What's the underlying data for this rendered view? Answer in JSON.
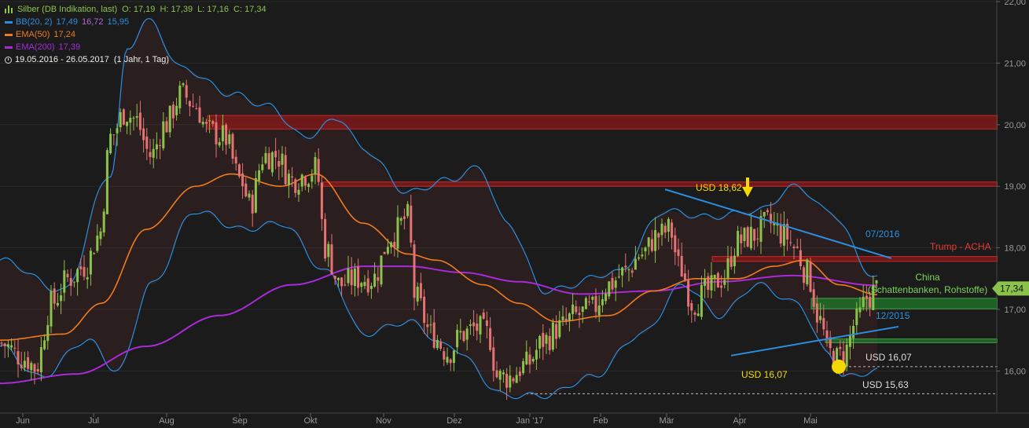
{
  "legend": {
    "main": {
      "name": "Silber (DB Indikation, last)",
      "ohlc": "O: 17,19  H: 17,39  L: 17,16  C: 17,34",
      "color": "#8bc34a"
    },
    "bb": {
      "name": "BB(20, 2)",
      "upper": "17,49",
      "mid": "16,72",
      "lower": "15,95",
      "color": "#2a8fe0"
    },
    "ema50": {
      "name": "EMA(50)",
      "value": "17,24",
      "color": "#f07b1d"
    },
    "ema200": {
      "name": "EMA(200)",
      "value": "17,39",
      "color": "#a82ad8"
    },
    "range": {
      "dates": "19.05.2016 - 26.05.2017",
      "period": "(1 Jahr, 1 Tag)"
    }
  },
  "chart_data": {
    "type": "candlestick",
    "x_tick_labels": [
      "Jun",
      "Jul",
      "Aug",
      "Sep",
      "Okt",
      "Nov",
      "Dez",
      "Jan '17",
      "Feb",
      "Mär",
      "Apr",
      "Mai"
    ],
    "y_tick_labels": [
      "16,00",
      "17,00",
      "18,00",
      "19,00",
      "20,00",
      "21,00",
      "22,00"
    ],
    "ylim": [
      15.57,
      22.0
    ],
    "last_price_label": "17,34",
    "close_path": [
      [
        "2016-05-19",
        16.45
      ],
      [
        "2016-05-30",
        16.2
      ],
      [
        "2016-06-03",
        16.05
      ],
      [
        "2016-06-10",
        17.1
      ],
      [
        "2016-06-17",
        17.5
      ],
      [
        "2016-06-24",
        17.7
      ],
      [
        "2016-06-30",
        18.2
      ],
      [
        "2016-07-05",
        19.8
      ],
      [
        "2016-07-11",
        20.2
      ],
      [
        "2016-07-15",
        20.1
      ],
      [
        "2016-07-22",
        19.5
      ],
      [
        "2016-07-28",
        20.0
      ],
      [
        "2016-08-04",
        20.5
      ],
      [
        "2016-08-10",
        20.3
      ],
      [
        "2016-08-15",
        19.9
      ],
      [
        "2016-08-22",
        19.8
      ],
      [
        "2016-08-29",
        19.1
      ],
      [
        "2016-09-02",
        18.7
      ],
      [
        "2016-09-08",
        19.5
      ],
      [
        "2016-09-13",
        19.5
      ],
      [
        "2016-09-20",
        19.1
      ],
      [
        "2016-09-26",
        19.2
      ],
      [
        "2016-09-30",
        19.3
      ],
      [
        "2016-10-04",
        18.0
      ],
      [
        "2016-10-10",
        17.4
      ],
      [
        "2016-10-17",
        17.5
      ],
      [
        "2016-10-24",
        17.5
      ],
      [
        "2016-11-01",
        18.2
      ],
      [
        "2016-11-08",
        18.5
      ],
      [
        "2016-11-11",
        17.2
      ],
      [
        "2016-11-18",
        16.6
      ],
      [
        "2016-11-25",
        16.3
      ],
      [
        "2016-12-01",
        16.6
      ],
      [
        "2016-12-07",
        16.7
      ],
      [
        "2016-12-12",
        16.6
      ],
      [
        "2016-12-16",
        15.9
      ],
      [
        "2016-12-21",
        15.9
      ],
      [
        "2016-12-28",
        16.1
      ],
      [
        "2017-01-05",
        16.5
      ],
      [
        "2017-01-11",
        16.7
      ],
      [
        "2017-01-18",
        16.9
      ],
      [
        "2017-01-25",
        17.0
      ],
      [
        "2017-02-01",
        17.4
      ],
      [
        "2017-02-08",
        17.6
      ],
      [
        "2017-02-15",
        17.9
      ],
      [
        "2017-02-22",
        18.2
      ],
      [
        "2017-02-27",
        18.3
      ],
      [
        "2017-03-03",
        17.7
      ],
      [
        "2017-03-09",
        17.1
      ],
      [
        "2017-03-15",
        17.3
      ],
      [
        "2017-03-21",
        17.5
      ],
      [
        "2017-03-28",
        18.1
      ],
      [
        "2017-04-03",
        18.2
      ],
      [
        "2017-04-10",
        18.4
      ],
      [
        "2017-04-17",
        18.2
      ],
      [
        "2017-04-21",
        18.0
      ],
      [
        "2017-04-26",
        17.6
      ],
      [
        "2017-05-02",
        16.8
      ],
      [
        "2017-05-05",
        16.3
      ],
      [
        "2017-05-09",
        16.2
      ],
      [
        "2017-05-12",
        16.3
      ],
      [
        "2017-05-17",
        16.8
      ],
      [
        "2017-05-22",
        17.2
      ],
      [
        "2017-05-26",
        17.34
      ]
    ],
    "bb_upper_path": [
      [
        "2016-05-19",
        17.8
      ],
      [
        "2016-06-15",
        17.3
      ],
      [
        "2016-07-05",
        19.2
      ],
      [
        "2016-07-12",
        21.2
      ],
      [
        "2016-07-20",
        21.7
      ],
      [
        "2016-08-05",
        20.9
      ],
      [
        "2016-08-25",
        20.5
      ],
      [
        "2016-09-10",
        20.3
      ],
      [
        "2016-09-25",
        19.8
      ],
      [
        "2016-10-10",
        20.1
      ],
      [
        "2016-10-20",
        19.6
      ],
      [
        "2016-11-08",
        18.9
      ],
      [
        "2016-11-25",
        19.1
      ],
      [
        "2016-12-08",
        19.3
      ],
      [
        "2016-12-20",
        18.4
      ],
      [
        "2017-01-05",
        17.3
      ],
      [
        "2017-02-05",
        17.6
      ],
      [
        "2017-02-25",
        18.6
      ],
      [
        "2017-03-15",
        18.5
      ],
      [
        "2017-04-05",
        18.6
      ],
      [
        "2017-04-22",
        19.0
      ],
      [
        "2017-05-05",
        18.6
      ],
      [
        "2017-05-26",
        17.5
      ]
    ],
    "bb_lower_path": [
      [
        "2016-05-19",
        16.4
      ],
      [
        "2016-06-05",
        15.9
      ],
      [
        "2016-06-25",
        16.5
      ],
      [
        "2016-07-08",
        16.0
      ],
      [
        "2016-07-22",
        17.4
      ],
      [
        "2016-08-10",
        18.6
      ],
      [
        "2016-08-30",
        18.3
      ],
      [
        "2016-09-15",
        18.4
      ],
      [
        "2016-10-05",
        17.6
      ],
      [
        "2016-10-20",
        16.6
      ],
      [
        "2016-11-08",
        16.8
      ],
      [
        "2016-11-25",
        16.4
      ],
      [
        "2016-12-20",
        15.6
      ],
      [
        "2017-01-05",
        15.6
      ],
      [
        "2017-01-25",
        15.9
      ],
      [
        "2017-02-15",
        16.6
      ],
      [
        "2017-03-05",
        17.4
      ],
      [
        "2017-03-20",
        16.9
      ],
      [
        "2017-04-05",
        17.4
      ],
      [
        "2017-04-22",
        17.1
      ],
      [
        "2017-05-05",
        16.3
      ],
      [
        "2017-05-12",
        15.9
      ],
      [
        "2017-05-26",
        16.0
      ]
    ],
    "ema50_path": [
      [
        "2016-05-19",
        16.5
      ],
      [
        "2016-06-15",
        16.6
      ],
      [
        "2016-07-01",
        17.1
      ],
      [
        "2016-07-20",
        18.3
      ],
      [
        "2016-08-10",
        19.0
      ],
      [
        "2016-08-25",
        19.2
      ],
      [
        "2016-09-15",
        19.0
      ],
      [
        "2016-09-30",
        19.2
      ],
      [
        "2016-10-20",
        18.4
      ],
      [
        "2016-11-08",
        17.9
      ],
      [
        "2016-11-20",
        17.8
      ],
      [
        "2016-12-10",
        17.4
      ],
      [
        "2016-12-25",
        17.1
      ],
      [
        "2017-01-10",
        16.8
      ],
      [
        "2017-02-01",
        16.9
      ],
      [
        "2017-02-20",
        17.3
      ],
      [
        "2017-03-10",
        17.5
      ],
      [
        "2017-03-28",
        17.5
      ],
      [
        "2017-04-12",
        17.7
      ],
      [
        "2017-04-25",
        17.8
      ],
      [
        "2017-05-10",
        17.4
      ],
      [
        "2017-05-26",
        17.24
      ]
    ],
    "ema200_path": [
      [
        "2016-05-19",
        15.8
      ],
      [
        "2016-06-20",
        15.95
      ],
      [
        "2016-07-20",
        16.4
      ],
      [
        "2016-08-20",
        16.9
      ],
      [
        "2016-09-20",
        17.4
      ],
      [
        "2016-10-20",
        17.7
      ],
      [
        "2016-11-08",
        17.7
      ],
      [
        "2016-12-01",
        17.6
      ],
      [
        "2016-12-25",
        17.45
      ],
      [
        "2017-01-20",
        17.25
      ],
      [
        "2017-02-20",
        17.3
      ],
      [
        "2017-03-20",
        17.45
      ],
      [
        "2017-04-20",
        17.55
      ],
      [
        "2017-05-26",
        17.39
      ]
    ],
    "zones": [
      {
        "y1": 19.93,
        "y2": 20.15,
        "color": "#8b1a1a",
        "start": "2016-08-15"
      },
      {
        "y1": 19.0,
        "y2": 19.07,
        "color": "#8b1a1a",
        "start": "2016-10-03"
      },
      {
        "y1": 17.78,
        "y2": 17.86,
        "color": "#8b1a1a",
        "start": "2017-03-17"
      },
      {
        "y1": 17.01,
        "y2": 17.18,
        "color": "#1f7a2a",
        "start": "2017-04-28"
      },
      {
        "y1": 16.46,
        "y2": 16.52,
        "color": "#1f7a2a",
        "start": "2017-05-04"
      }
    ],
    "trendlines": [
      {
        "label": "07/2016",
        "from": [
          "2017-02-25",
          18.95
        ],
        "to": [
          "2017-06-01",
          17.83
        ],
        "color": "#2a8fe0"
      },
      {
        "label": "12/2015",
        "from": [
          "2017-03-25",
          16.25
        ],
        "to": [
          "2017-06-04",
          16.72
        ],
        "color": "#2a8fe0"
      }
    ],
    "dashed_lines": [
      {
        "label": "USD 16,07",
        "y": 16.07,
        "start": "2017-05-12"
      },
      {
        "label": "USD 15,63",
        "y": 15.63,
        "start": "2016-12-28"
      }
    ],
    "annotations": {
      "usd1862": {
        "label": "USD 18,62",
        "date": "2017-04-13",
        "value": 18.62
      },
      "usd1607": {
        "label": "USD 16,07",
        "date": "2017-05-09",
        "value": 16.07
      },
      "trump": {
        "label": "Trump - ACHA"
      },
      "china_1": {
        "label": "China"
      },
      "china_2": {
        "label": "(Schattenbanken, Rohstoffe)"
      }
    },
    "colors": {
      "up": "#8bc34a",
      "down": "#e57373",
      "grid": "#2a2a2a",
      "axis_text": "#9a9a9a",
      "bb": "#2a8fe0",
      "ema50": "#f07b1d",
      "ema200": "#a82ad8",
      "red_text": "#e53935",
      "green_text": "#7cd35a",
      "yellow": "#f5d800"
    }
  }
}
